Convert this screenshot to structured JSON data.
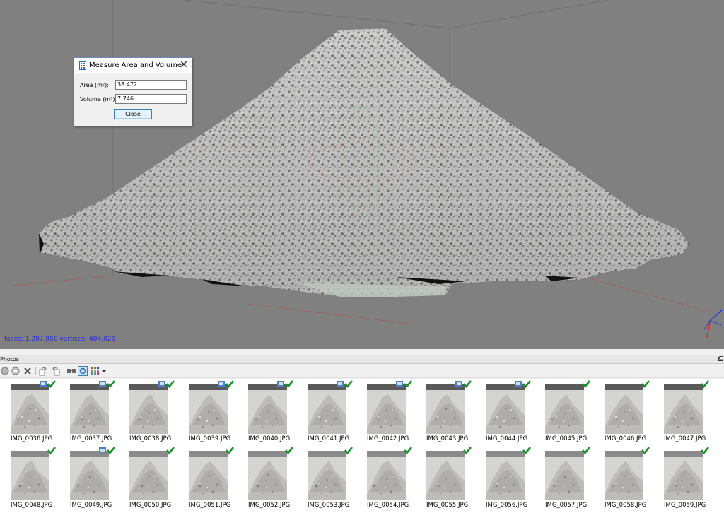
{
  "viewport": {
    "stats": "faces: 1,207,950 vertices: 604,029",
    "background": "#808080",
    "model": "textured-point-cloud-mesh"
  },
  "dialog": {
    "title": "Measure Area and Volume",
    "area_label": "Area (m²):",
    "area_value": "38.472",
    "volume_label": "Volume (m³):",
    "volume_value": "7.746",
    "close_button": "Close",
    "close_icon": "close-icon"
  },
  "photos_panel": {
    "title": "Photos",
    "toolbar": [
      "add-photo-icon",
      "remove-icon",
      "delete-icon",
      "rotate-left-icon",
      "rotate-right-icon",
      "search-icon",
      "detail-view-icon",
      "thumbnail-view-icon",
      "dropdown-icon"
    ],
    "accent": "#1a8f2c",
    "photos": [
      {
        "name": "IMG_0036.JPG",
        "aligned": true,
        "has_badge": true
      },
      {
        "name": "IMG_0037.JPG",
        "aligned": true,
        "has_badge": true
      },
      {
        "name": "IMG_0038.JPG",
        "aligned": true,
        "has_badge": true
      },
      {
        "name": "IMG_0039.JPG",
        "aligned": true,
        "has_badge": true
      },
      {
        "name": "IMG_0040.JPG",
        "aligned": true,
        "has_badge": true
      },
      {
        "name": "IMG_0041.JPG",
        "aligned": true,
        "has_badge": true
      },
      {
        "name": "IMG_0042.JPG",
        "aligned": true,
        "has_badge": true
      },
      {
        "name": "IMG_0043.JPG",
        "aligned": true,
        "has_badge": true
      },
      {
        "name": "IMG_0044.JPG",
        "aligned": true,
        "has_badge": true
      },
      {
        "name": "IMG_0045.JPG",
        "aligned": true,
        "has_badge": false
      },
      {
        "name": "IMG_0046.JPG",
        "aligned": true,
        "has_badge": false
      },
      {
        "name": "IMG_0047.JPG",
        "aligned": true,
        "has_badge": false
      },
      {
        "name": "IMG_0048.JPG",
        "aligned": true,
        "has_badge": false
      },
      {
        "name": "IMG_0049.JPG",
        "aligned": true,
        "has_badge": true
      },
      {
        "name": "IMG_0050.JPG",
        "aligned": true,
        "has_badge": false
      },
      {
        "name": "IMG_0051.JPG",
        "aligned": true,
        "has_badge": false
      },
      {
        "name": "IMG_0052.JPG",
        "aligned": true,
        "has_badge": false
      },
      {
        "name": "IMG_0053.JPG",
        "aligned": true,
        "has_badge": false
      },
      {
        "name": "IMG_0054.JPG",
        "aligned": true,
        "has_badge": false
      },
      {
        "name": "IMG_0055.JPG",
        "aligned": true,
        "has_badge": false
      },
      {
        "name": "IMG_0056.JPG",
        "aligned": true,
        "has_badge": false
      },
      {
        "name": "IMG_0057.JPG",
        "aligned": true,
        "has_badge": false
      },
      {
        "name": "IMG_0058.JPG",
        "aligned": true,
        "has_badge": false
      },
      {
        "name": "IMG_0059.JPG",
        "aligned": true,
        "has_badge": false
      }
    ]
  }
}
